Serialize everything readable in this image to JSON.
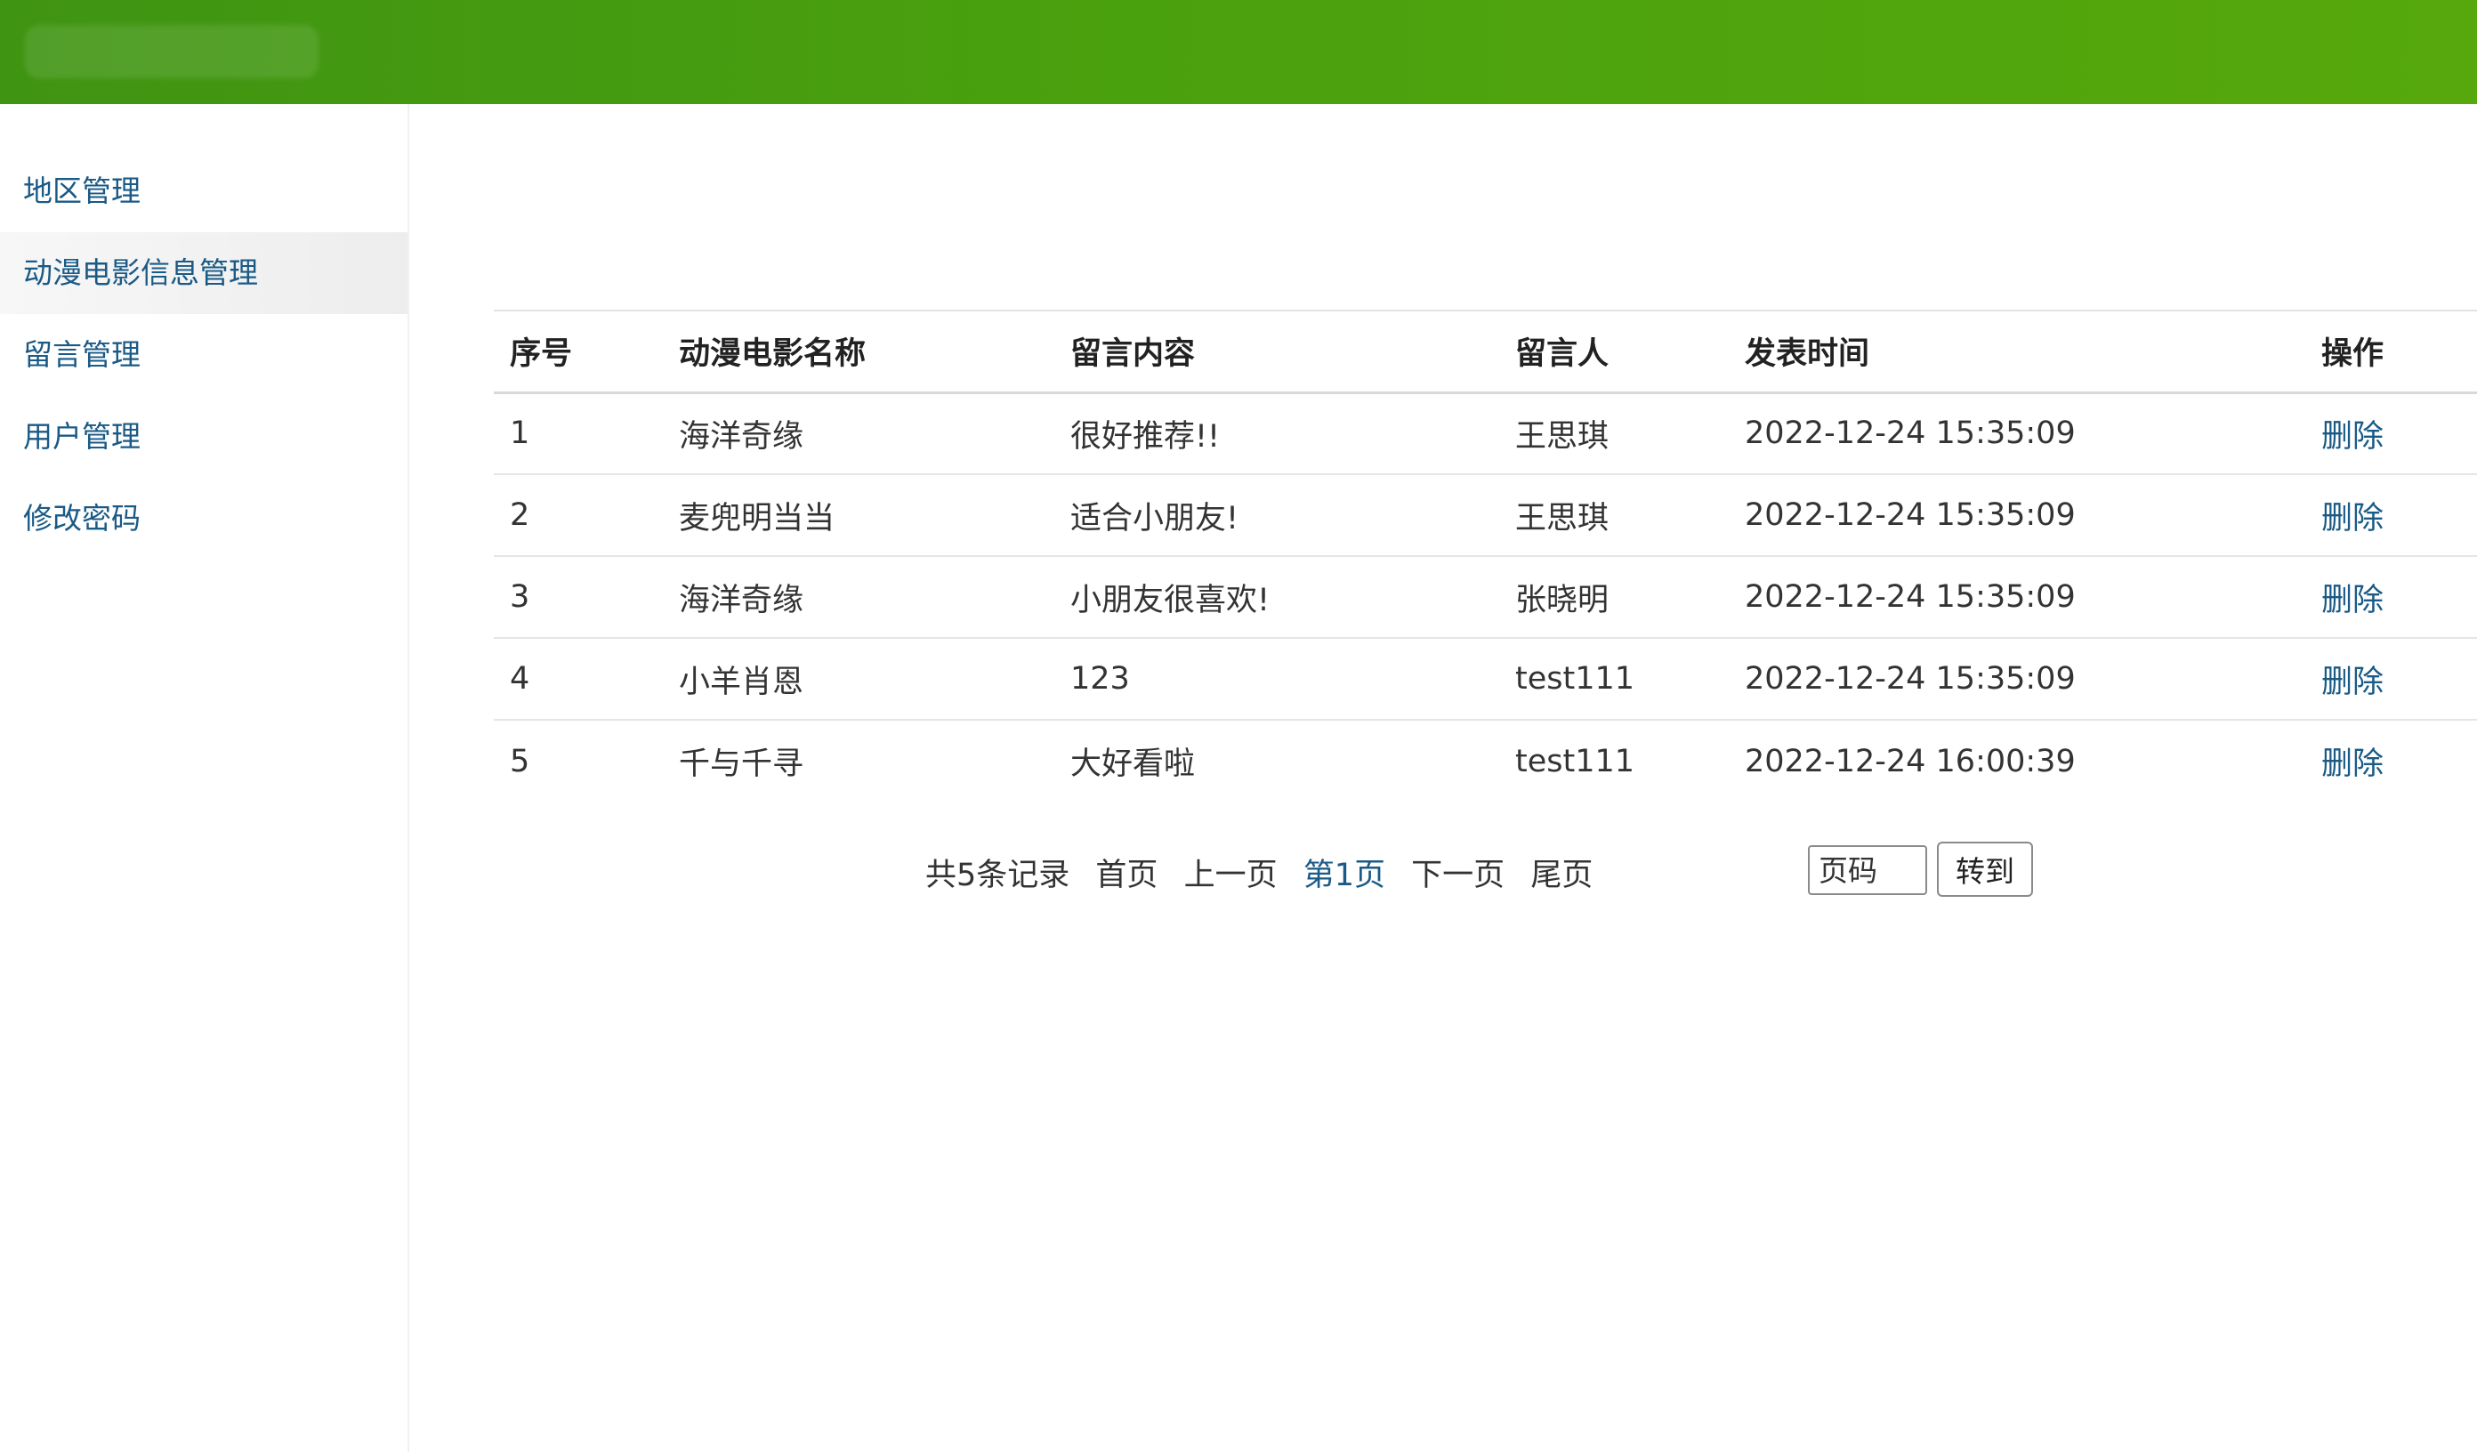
{
  "sidebar": {
    "items": [
      {
        "label": "地区管理"
      },
      {
        "label": "动漫电影信息管理"
      },
      {
        "label": "留言管理"
      },
      {
        "label": "用户管理"
      },
      {
        "label": "修改密码"
      }
    ]
  },
  "table": {
    "headers": [
      "序号",
      "动漫电影名称",
      "留言内容",
      "留言人",
      "发表时间",
      "操作"
    ],
    "rows": [
      {
        "no": "1",
        "movie": "海洋奇缘",
        "content": "很好推荐!!",
        "user": "王思琪",
        "time": "2022-12-24 15:35:09",
        "action": "删除"
      },
      {
        "no": "2",
        "movie": "麦兜明当当",
        "content": "适合小朋友!",
        "user": "王思琪",
        "time": "2022-12-24 15:35:09",
        "action": "删除"
      },
      {
        "no": "3",
        "movie": "海洋奇缘",
        "content": "小朋友很喜欢!",
        "user": "张晓明",
        "time": "2022-12-24 15:35:09",
        "action": "删除"
      },
      {
        "no": "4",
        "movie": "小羊肖恩",
        "content": "123",
        "user": "test111",
        "time": "2022-12-24 15:35:09",
        "action": "删除"
      },
      {
        "no": "5",
        "movie": "千与千寻",
        "content": "大好看啦",
        "user": "test111",
        "time": "2022-12-24 16:00:39",
        "action": "删除"
      }
    ]
  },
  "pager": {
    "total": "共5条记录",
    "first": "首页",
    "prev": "上一页",
    "current": "第1页",
    "next": "下一页",
    "last": "尾页",
    "input_placeholder": "页码",
    "goto_label": "转到"
  },
  "colors": {
    "header_green": "#4aa10e",
    "link_blue": "#1a5a86"
  }
}
